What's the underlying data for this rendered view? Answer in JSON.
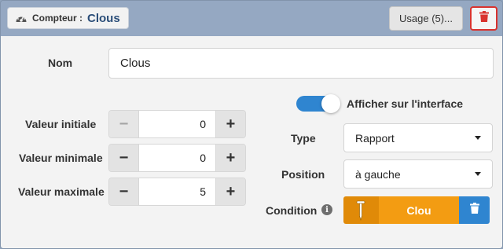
{
  "header": {
    "title_prefix": "Compteur :",
    "title_name": "Clous",
    "usage_button": "Usage (5)..."
  },
  "form": {
    "name_label": "Nom",
    "name_value": "Clous",
    "initial": {
      "label": "Valeur initiale",
      "value": "0",
      "minus": "−",
      "plus": "+"
    },
    "minimum": {
      "label": "Valeur minimale",
      "value": "0",
      "minus": "−",
      "plus": "+"
    },
    "maximum": {
      "label": "Valeur maximale",
      "value": "5",
      "minus": "−",
      "plus": "+"
    },
    "show_toggle": {
      "label": "Afficher sur l'interface",
      "on": true
    },
    "type": {
      "label": "Type",
      "value": "Rapport"
    },
    "position": {
      "label": "Position",
      "value": "à gauche"
    },
    "condition": {
      "label": "Condition",
      "info_glyph": "i",
      "value": "Clou",
      "icon": "nail-icon"
    }
  },
  "colors": {
    "header_bg": "#95a8c2",
    "title_name": "#2a4d78",
    "delete_red": "#d9332f",
    "toggle_blue": "#2f85d0",
    "condition_orange": "#f39c12",
    "condition_dark_orange": "#e08a08"
  }
}
